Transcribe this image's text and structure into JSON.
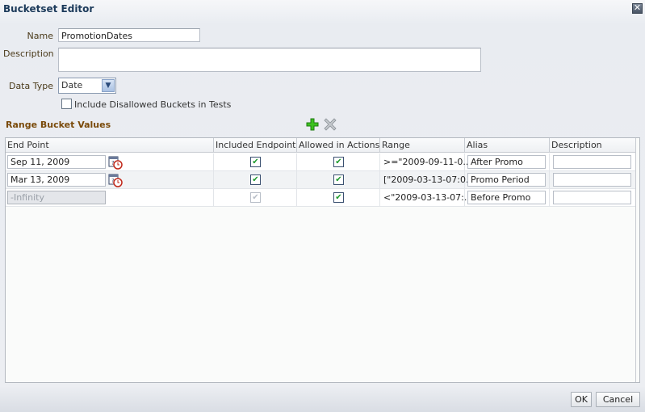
{
  "dialog": {
    "title": "Bucketset Editor",
    "close_icon": "close-icon"
  },
  "form": {
    "name_label": "Name",
    "name_value": "PromotionDates",
    "description_label": "Description",
    "description_value": "",
    "data_type_label": "Data Type",
    "data_type_value": "Date",
    "include_disallowed_label": "Include Disallowed Buckets in Tests",
    "include_disallowed_checked": false
  },
  "section": {
    "title": "Range Bucket Values",
    "add_icon": "add-icon",
    "delete_icon": "delete-icon"
  },
  "table": {
    "columns": [
      "End Point",
      "Included Endpoint",
      "Allowed in Actions",
      "Range",
      "Alias",
      "Description"
    ],
    "rows": [
      {
        "end_point": "Sep 11, 2009",
        "end_point_disabled": false,
        "included_endpoint": true,
        "included_disabled": false,
        "allowed_in_actions": true,
        "range": ">=\"2009-09-11-0...",
        "alias": "After Promo",
        "description": ""
      },
      {
        "end_point": "Mar 13, 2009",
        "end_point_disabled": false,
        "included_endpoint": true,
        "included_disabled": false,
        "allowed_in_actions": true,
        "range": "[\"2009-03-13-07:0...",
        "alias": "Promo Period",
        "description": ""
      },
      {
        "end_point": "-Infinity",
        "end_point_disabled": true,
        "included_endpoint": true,
        "included_disabled": true,
        "allowed_in_actions": true,
        "range": "<\"2009-03-13-07:...",
        "alias": "Before Promo",
        "description": ""
      }
    ]
  },
  "buttons": {
    "ok": "OK",
    "cancel": "Cancel"
  }
}
